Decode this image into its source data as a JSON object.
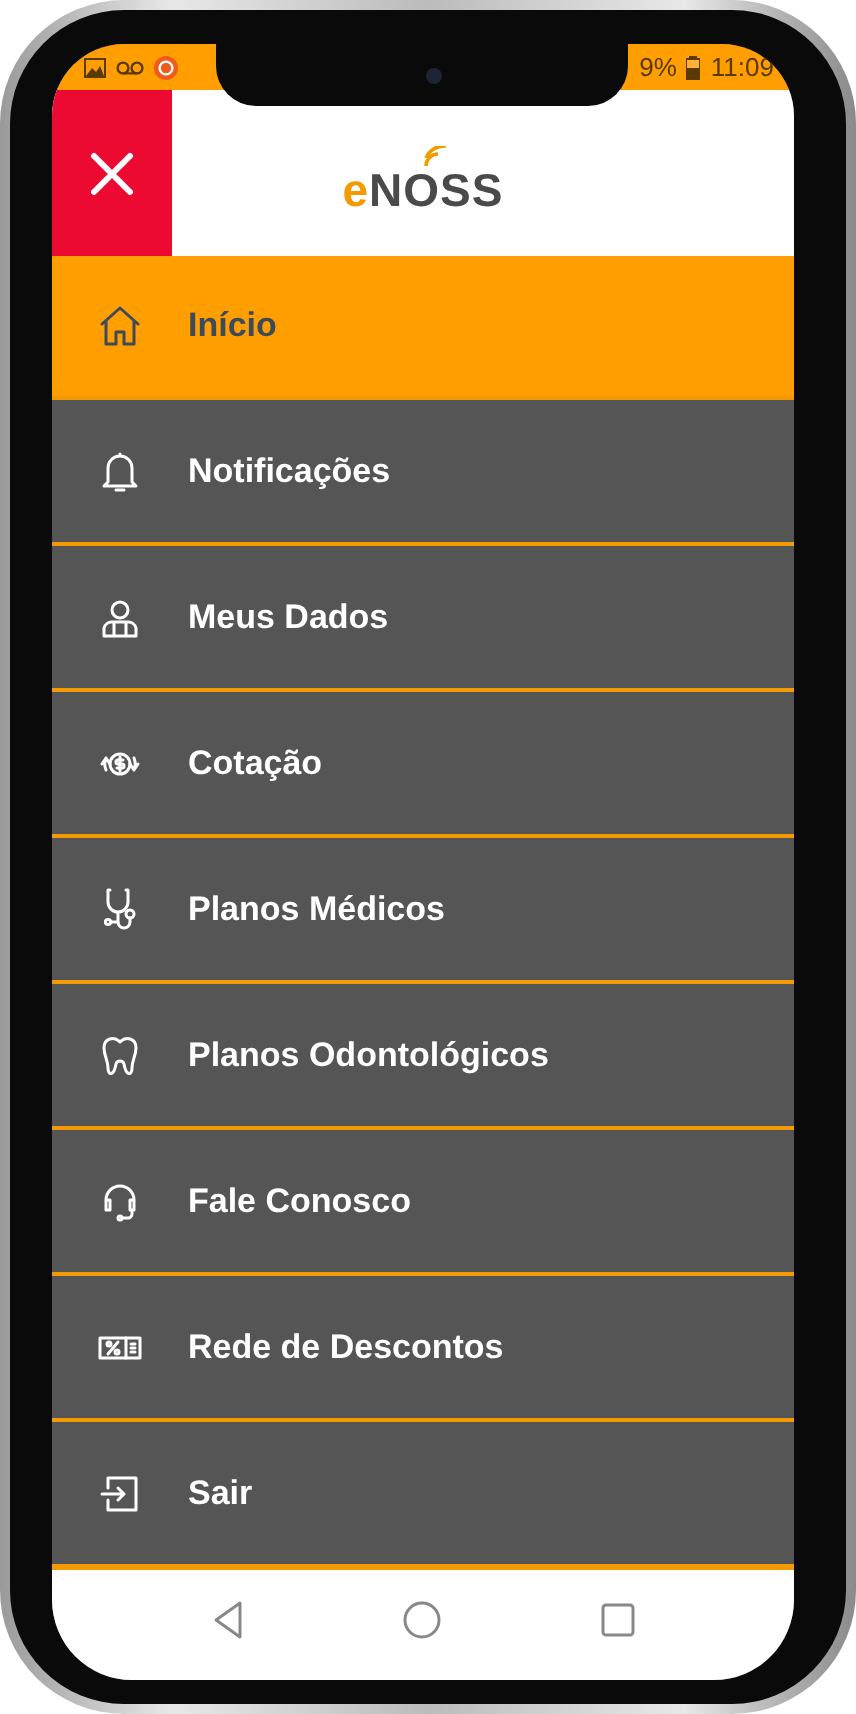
{
  "status_bar": {
    "battery": "9%",
    "time": "11:09"
  },
  "header": {
    "logo": "eNOSS"
  },
  "menu": [
    {
      "label": "Início",
      "selected": true
    },
    {
      "label": "Notificações",
      "selected": false
    },
    {
      "label": "Meus Dados",
      "selected": false
    },
    {
      "label": "Cotação",
      "selected": false
    },
    {
      "label": "Planos Médicos",
      "selected": false
    },
    {
      "label": "Planos Odontológicos",
      "selected": false
    },
    {
      "label": "Fale Conosco",
      "selected": false
    },
    {
      "label": "Rede de Descontos",
      "selected": false
    },
    {
      "label": "Sair",
      "selected": false
    }
  ]
}
